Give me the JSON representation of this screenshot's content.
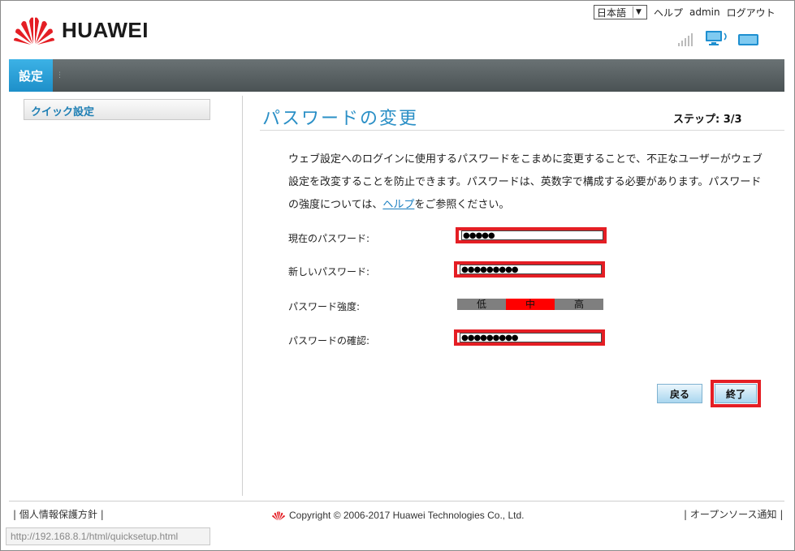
{
  "brand": {
    "name": "HUAWEI",
    "logo_color": "#e41e24"
  },
  "top_bar": {
    "language": "日本語",
    "help": "ヘルプ",
    "user": "admin",
    "logout": "ログアウト"
  },
  "status_icons": [
    "signal-strength-icon",
    "computer-connection-icon",
    "battery-icon"
  ],
  "nav": {
    "active_tab": "設定",
    "accent": "#2aa3dc"
  },
  "sidebar": {
    "items": [
      {
        "label": "クイック設定"
      }
    ]
  },
  "main": {
    "title": "パスワードの変更",
    "step": "ステップ: 3/3",
    "description_part1": "ウェブ設定へのログインに使用するパスワードをこまめに変更することで、不正なユーザーがウェブ設定を改変することを防止できます。パスワードは、英数字で構成する必要があります。パスワードの強度については、",
    "description_link": "ヘルプ",
    "description_part2": "をご参照ください。",
    "fields": {
      "current_label": "現在のパスワード:",
      "current_value": "●●●●●",
      "new_label": "新しいパスワード:",
      "new_value": "●●●●●●●●●",
      "strength_label": "パスワード強度:",
      "confirm_label": "パスワードの確認:",
      "confirm_value": "●●●●●●●●●"
    },
    "strength": {
      "low": "低",
      "medium": "中",
      "high": "高",
      "level": "中"
    },
    "buttons": {
      "back": "戻る",
      "finish": "終了"
    },
    "highlight_color": "#e41e24"
  },
  "footer": {
    "privacy": "個人情報保護方針",
    "copyright": "Copyright © 2006-2017 Huawei Technologies Co., Ltd.",
    "open_source": "オープンソース通知"
  },
  "status_url": "http://192.168.8.1/html/quicksetup.html"
}
